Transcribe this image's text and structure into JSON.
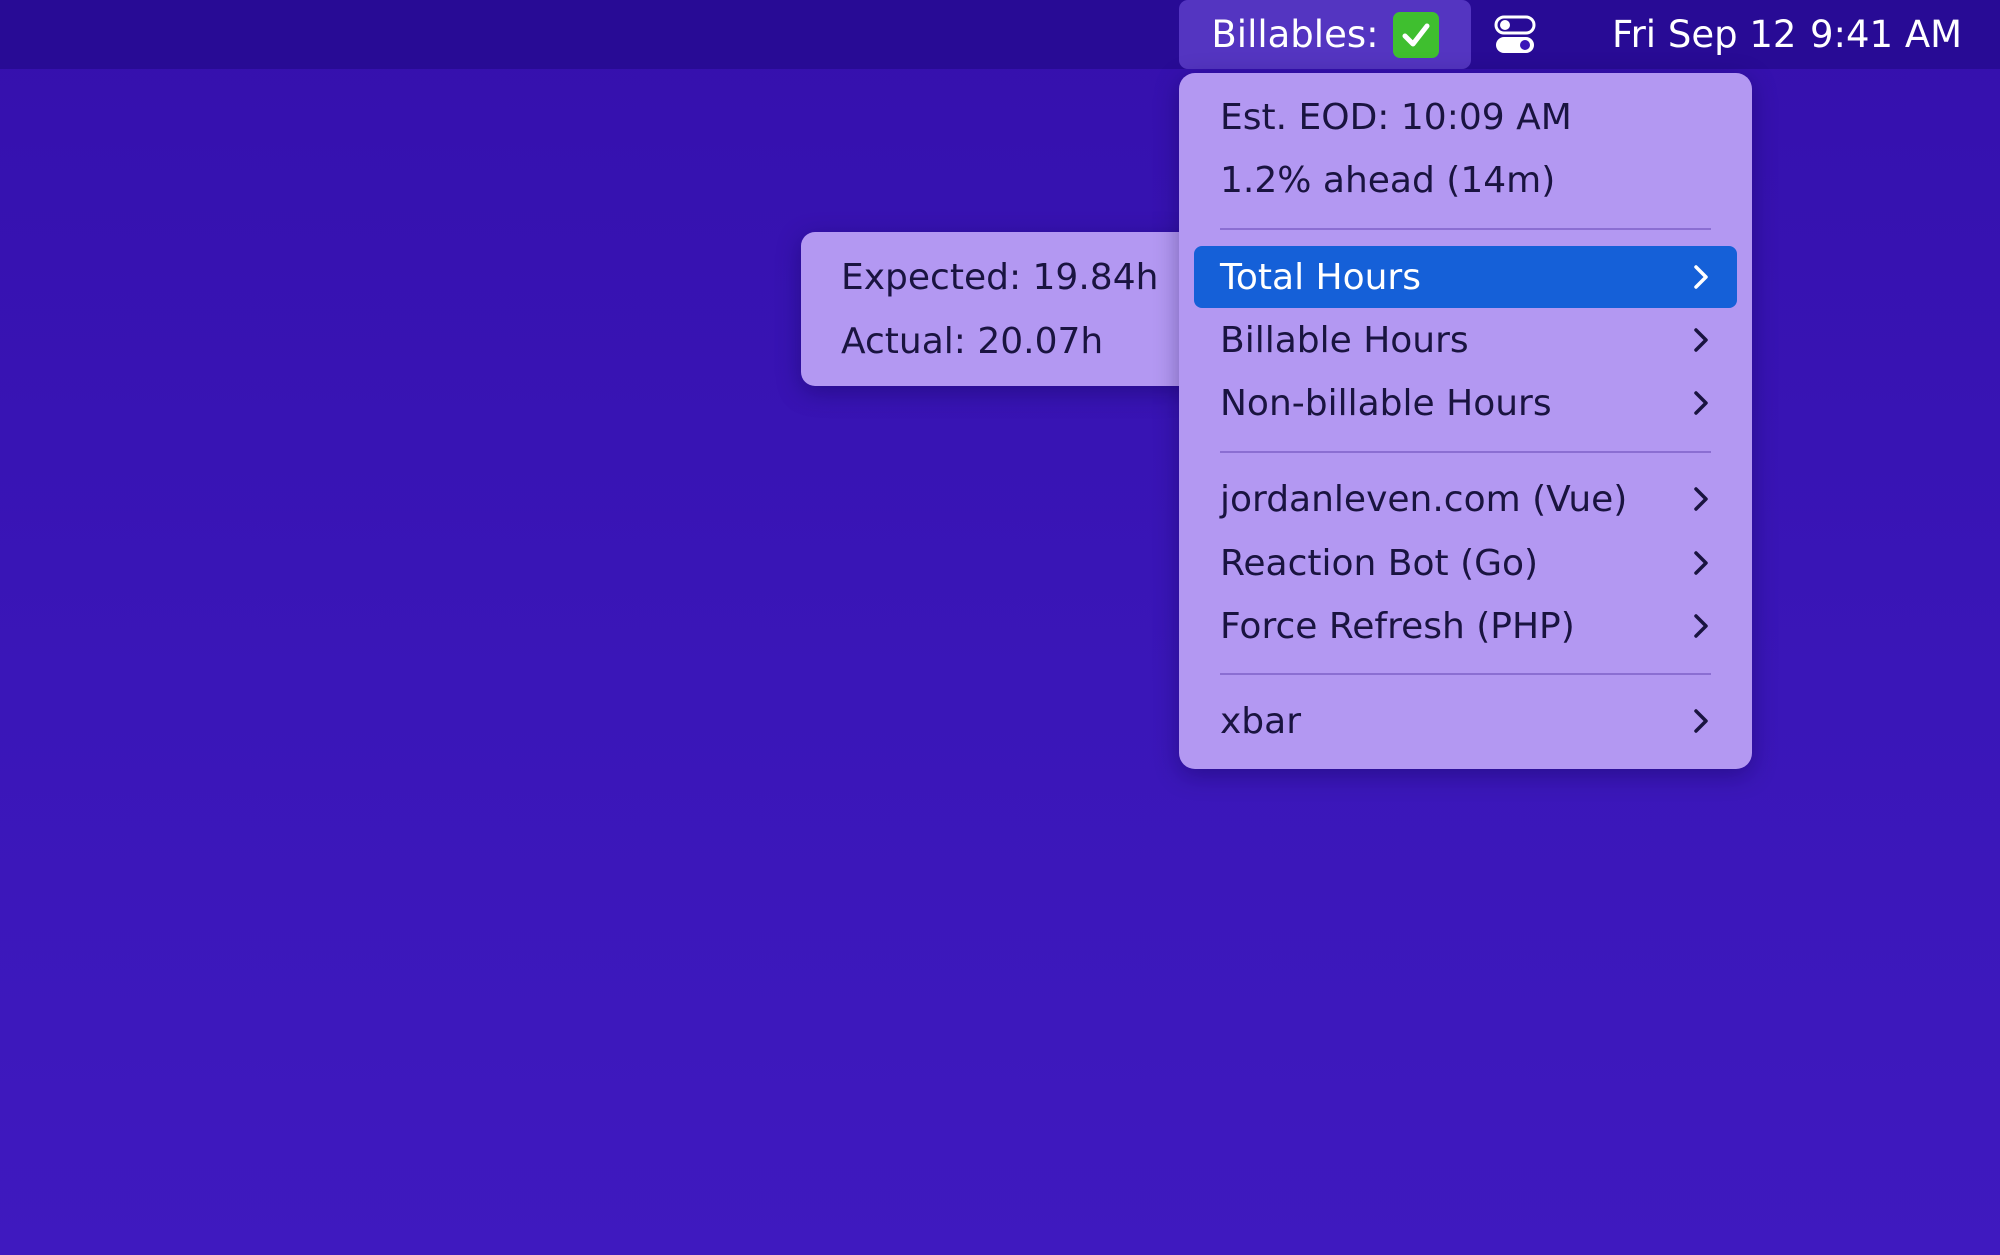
{
  "menubar": {
    "app_label": "Billables:",
    "status_icon": "check-mark-icon",
    "control_icon": "toggle-switch-icon",
    "date": "Fri Sep 12",
    "time": "9:41 AM"
  },
  "menu": {
    "eod": "Est. EOD: 10:09 AM",
    "pace": "1.2% ahead (14m)",
    "items": [
      {
        "label": "Total Hours"
      },
      {
        "label": "Billable Hours"
      },
      {
        "label": "Non-billable Hours"
      },
      {
        "label": "jordanleven.com (Vue)"
      },
      {
        "label": "Reaction Bot (Go)"
      },
      {
        "label": "Force Refresh (PHP)"
      },
      {
        "label": "xbar"
      }
    ]
  },
  "submenu": {
    "expected": "Expected: 19.84h",
    "actual": "Actual: 20.07h"
  },
  "colors": {
    "desktop": "#3a16b8",
    "menu_bg": "#b398f2",
    "highlight": "#1560d8",
    "check": "#3fbf2f"
  }
}
